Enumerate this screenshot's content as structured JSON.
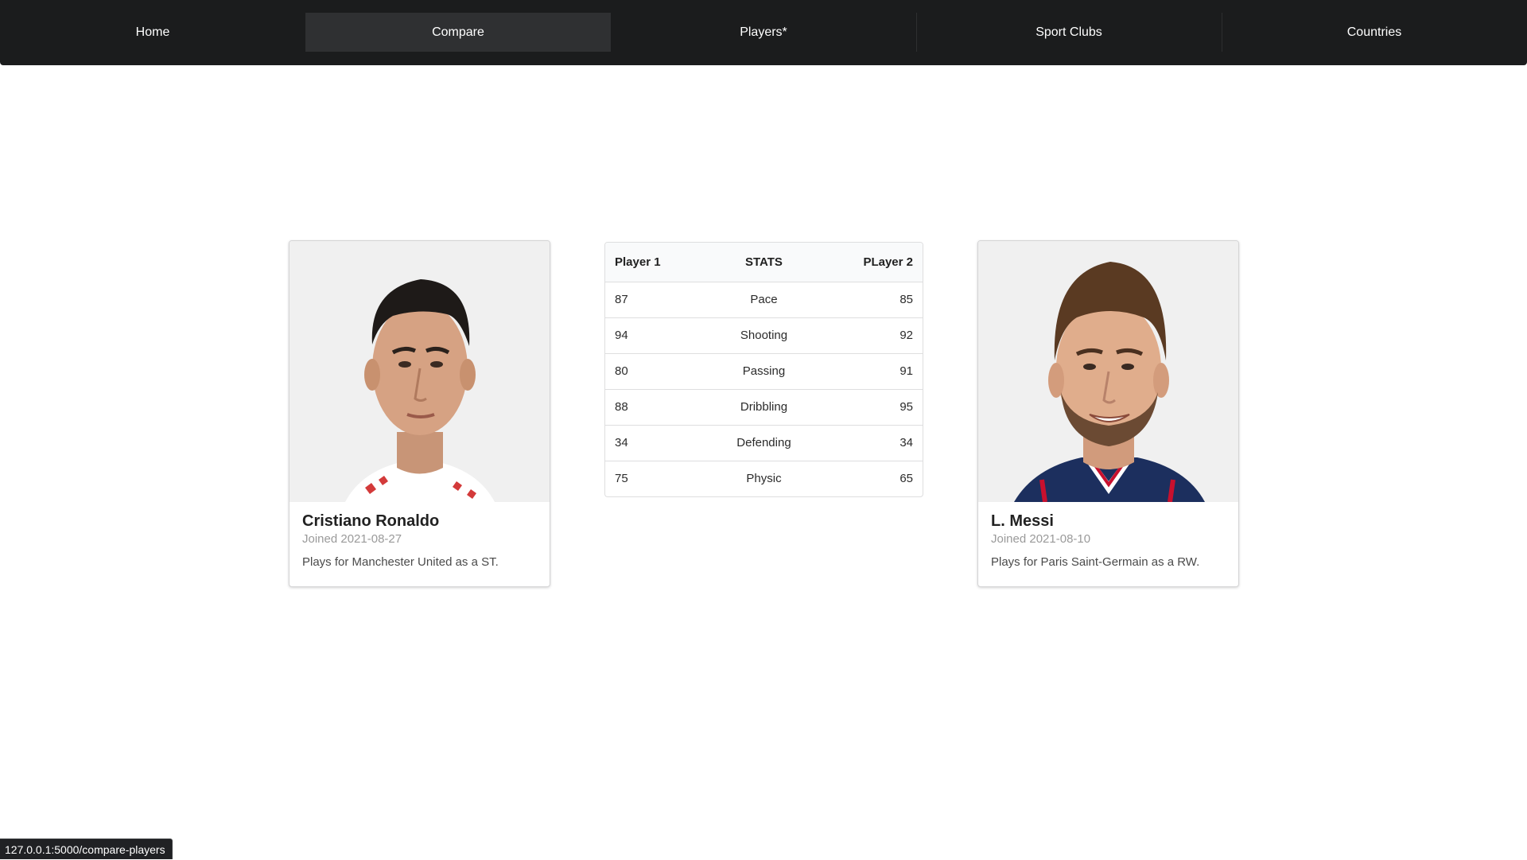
{
  "nav": {
    "items": [
      {
        "label": "Home"
      },
      {
        "label": "Compare"
      },
      {
        "label": "Players*"
      },
      {
        "label": "Sport Clubs"
      },
      {
        "label": "Countries"
      }
    ],
    "active": "Compare"
  },
  "player1": {
    "name": "Cristiano Ronaldo",
    "joined": "Joined 2021-08-27",
    "description": "Plays for Manchester United as a ST."
  },
  "player2": {
    "name": "L. Messi",
    "joined": "Joined 2021-08-10",
    "description": "Plays for Paris Saint-Germain as a RW."
  },
  "stats": {
    "headers": {
      "left": "Player 1",
      "middle": "STATS",
      "right": "PLayer 2"
    },
    "rows": [
      {
        "p1": "87",
        "stat": "Pace",
        "p2": "85"
      },
      {
        "p1": "94",
        "stat": "Shooting",
        "p2": "92"
      },
      {
        "p1": "80",
        "stat": "Passing",
        "p2": "91"
      },
      {
        "p1": "88",
        "stat": "Dribbling",
        "p2": "95"
      },
      {
        "p1": "34",
        "stat": "Defending",
        "p2": "34"
      },
      {
        "p1": "75",
        "stat": "Physic",
        "p2": "65"
      }
    ]
  },
  "status_url": "127.0.0.1:5000/compare-players",
  "colors": {
    "nav_bg": "#1b1c1d",
    "nav_active": "#2f3032",
    "card_border": "#d4d4d5",
    "meta_text": "#9a9a9a"
  }
}
